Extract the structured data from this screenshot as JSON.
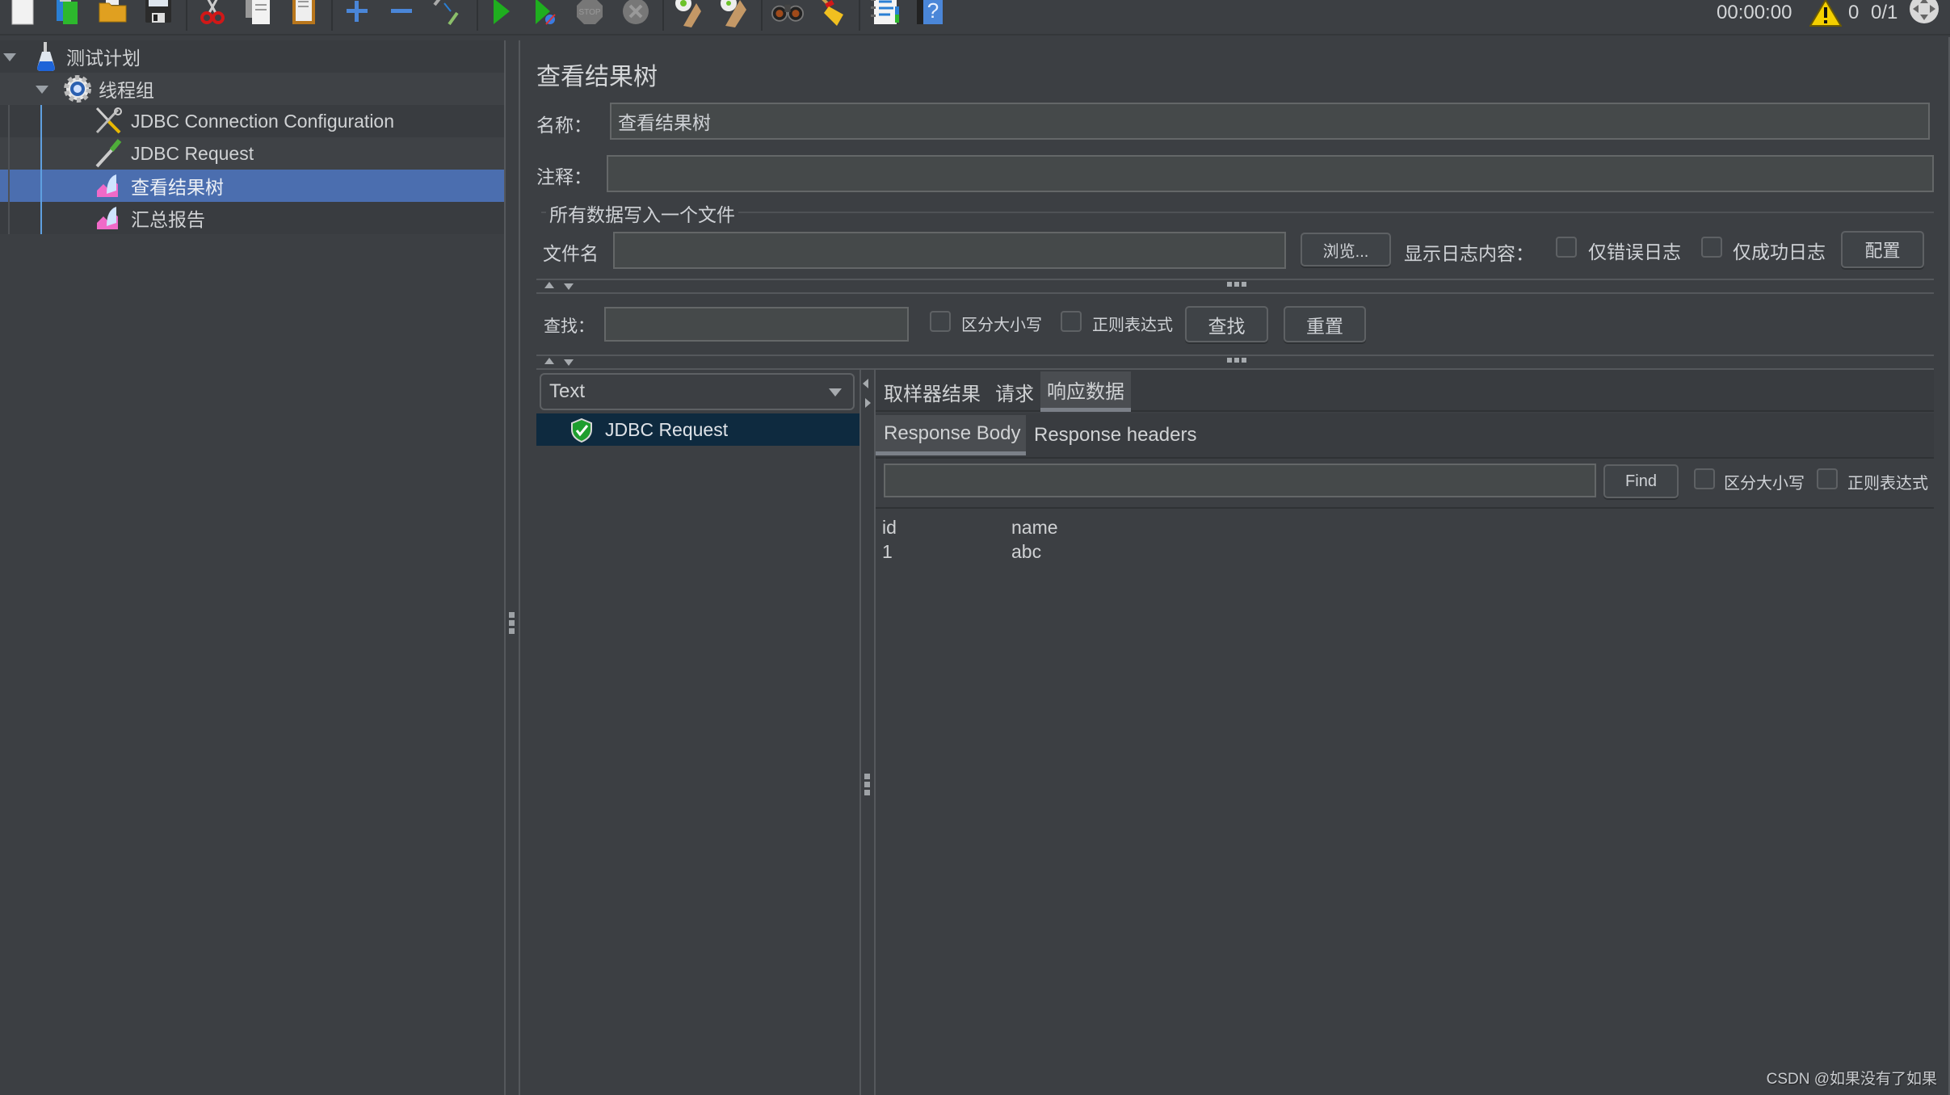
{
  "toolbar": {
    "icons": [
      {
        "name": "new-icon"
      },
      {
        "name": "templates-icon"
      },
      {
        "name": "open-icon"
      },
      {
        "name": "save-icon"
      },
      {
        "name": "cut-icon"
      },
      {
        "name": "copy-icon"
      },
      {
        "name": "paste-icon"
      },
      {
        "name": "expand-icon"
      },
      {
        "name": "collapse-icon"
      },
      {
        "name": "toggle-icon"
      },
      {
        "name": "start-icon"
      },
      {
        "name": "start-no-pauses-icon"
      },
      {
        "name": "stop-icon"
      },
      {
        "name": "shutdown-icon"
      },
      {
        "name": "clear-icon"
      },
      {
        "name": "clear-all-icon"
      },
      {
        "name": "search-binoculars-icon"
      },
      {
        "name": "reset-search-broom-icon"
      },
      {
        "name": "function-helper-icon"
      },
      {
        "name": "help-icon"
      }
    ],
    "timer": "00:00:00",
    "warning_count": "0",
    "threads": "0/1"
  },
  "tree": {
    "items": [
      {
        "label": "测试计划",
        "icon": "test-plan-flask-icon",
        "level": 0,
        "expanded": true
      },
      {
        "label": "线程组",
        "icon": "thread-group-gear-icon",
        "level": 1,
        "expanded": true
      },
      {
        "label": "JDBC Connection Configuration",
        "icon": "config-tools-icon",
        "level": 2
      },
      {
        "label": "JDBC Request",
        "icon": "sampler-pipette-icon",
        "level": 2
      },
      {
        "label": "查看结果树",
        "icon": "listener-graph-icon",
        "level": 2,
        "selected": true
      },
      {
        "label": "汇总报告",
        "icon": "listener-graph-icon",
        "level": 2
      }
    ]
  },
  "panel": {
    "title": "查看结果树",
    "name_label": "名称：",
    "name_value": "查看结果树",
    "comment_label": "注释：",
    "comment_value": "",
    "file_group_label": "所有数据写入一个文件",
    "filename_label": "文件名",
    "filename_value": "",
    "browse_button": "浏览...",
    "log_display_label": "显示日志内容：",
    "errors_only_label": "仅错误日志",
    "success_only_label": "仅成功日志",
    "configure_button": "配置",
    "search_label": "查找：",
    "search_value": "",
    "case_sensitive_label": "区分大小写",
    "regex_label": "正则表达式",
    "find_button": "查找",
    "reset_button": "重置"
  },
  "results": {
    "renderer_selected": "Text",
    "items": [
      {
        "label": "JDBC Request",
        "status": "success"
      }
    ],
    "tabs": [
      {
        "label": "取样器结果",
        "active": false
      },
      {
        "label": "请求",
        "active": false
      },
      {
        "label": "响应数据",
        "active": true
      }
    ],
    "subtabs": [
      {
        "label": "Response Body",
        "active": true
      },
      {
        "label": "Response headers",
        "active": false
      }
    ],
    "find_value": "",
    "find_button": "Find",
    "case_sensitive_label": "区分大小写",
    "regex_label": "正则表达式",
    "body": {
      "columns": [
        "id",
        "name"
      ],
      "rows": [
        [
          "1",
          "abc"
        ]
      ]
    }
  },
  "watermark": "CSDN @如果没有了如果"
}
